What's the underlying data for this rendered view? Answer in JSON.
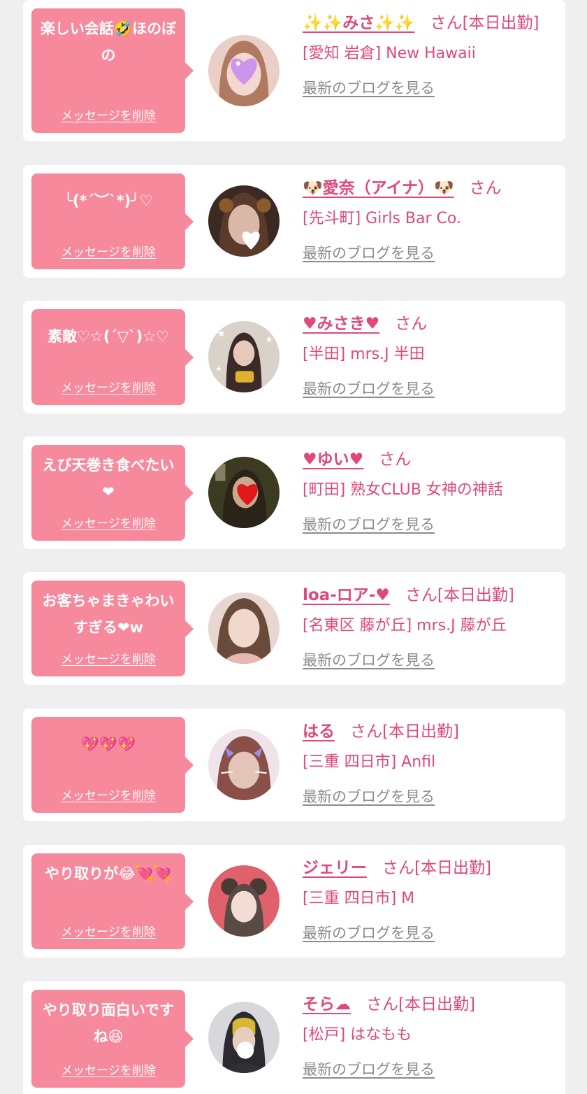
{
  "colors": {
    "page_bg": "#efefef",
    "card_bg": "#ffffff",
    "bubble_bg": "#f7899c",
    "name_pink": "#e0487a",
    "blog_gray": "#8c8c8c"
  },
  "messages": [
    {
      "message": "楽しい会話🤣ほのぼの",
      "delete_label": "メッセージを削除",
      "name": "✨✨みさ✨✨",
      "suffix": "さん[本日出勤]",
      "shop": "[愛知 岩倉] New Hawaii",
      "blog_label": "最新のブログを見る",
      "avatar_icon": "girl-photo-heart-sticker"
    },
    {
      "message": "╰(*´︶`*)╯♡",
      "delete_label": "メッセージを削除",
      "name": "🐶愛奈（アイナ）🐶",
      "suffix": "さん",
      "shop": "[先斗町] Girls Bar Co.",
      "blog_label": "最新のブログを見る",
      "avatar_icon": "girl-photo-white-heart"
    },
    {
      "message": "素敵♡☆(´▽`)☆♡",
      "delete_label": "メッセージを削除",
      "name": "♥みさき♥",
      "suffix": "さん",
      "shop": "[半田] mrs.J 半田",
      "blog_label": "最新のブログを見る",
      "avatar_icon": "girl-photo-stars"
    },
    {
      "message": "えび天巻き食べたい❤",
      "delete_label": "メッセージを削除",
      "name": "♥ゆい♥",
      "suffix": "さん",
      "shop": "[町田] 熟女CLUB 女神の神話",
      "blog_label": "最新のブログを見る",
      "avatar_icon": "girl-photo-red-heart"
    },
    {
      "message": "お客ちゃまきゃわいすぎる❤w",
      "delete_label": "メッセージを削除",
      "name": "loa-ロア-♥",
      "suffix": "さん[本日出勤]",
      "shop": "[名東区 藤が丘] mrs.J 藤が丘",
      "blog_label": "最新のブログを見る",
      "avatar_icon": "girl-photo"
    },
    {
      "message": "💖💖💖",
      "delete_label": "メッセージを削除",
      "name": "はる",
      "suffix": "さん[本日出勤]",
      "shop": "[三重 四日市] Anfil",
      "blog_label": "最新のブログを見る",
      "avatar_icon": "girl-photo-cat-filter"
    },
    {
      "message": "やり取りが😂💘💘",
      "delete_label": "メッセージを削除",
      "name": "ジェリー",
      "suffix": "さん[本日出勤]",
      "shop": "[三重 四日市] M",
      "blog_label": "最新のブログを見る",
      "avatar_icon": "girl-photo-red-background"
    },
    {
      "message": "やり取り面白いですね😆",
      "delete_label": "メッセージを削除",
      "name": "そら☁",
      "suffix": "さん[本日出勤]",
      "shop": "[松戸] はなもも",
      "blog_label": "最新のブログを見る",
      "avatar_icon": "girl-photo-sticker"
    }
  ]
}
